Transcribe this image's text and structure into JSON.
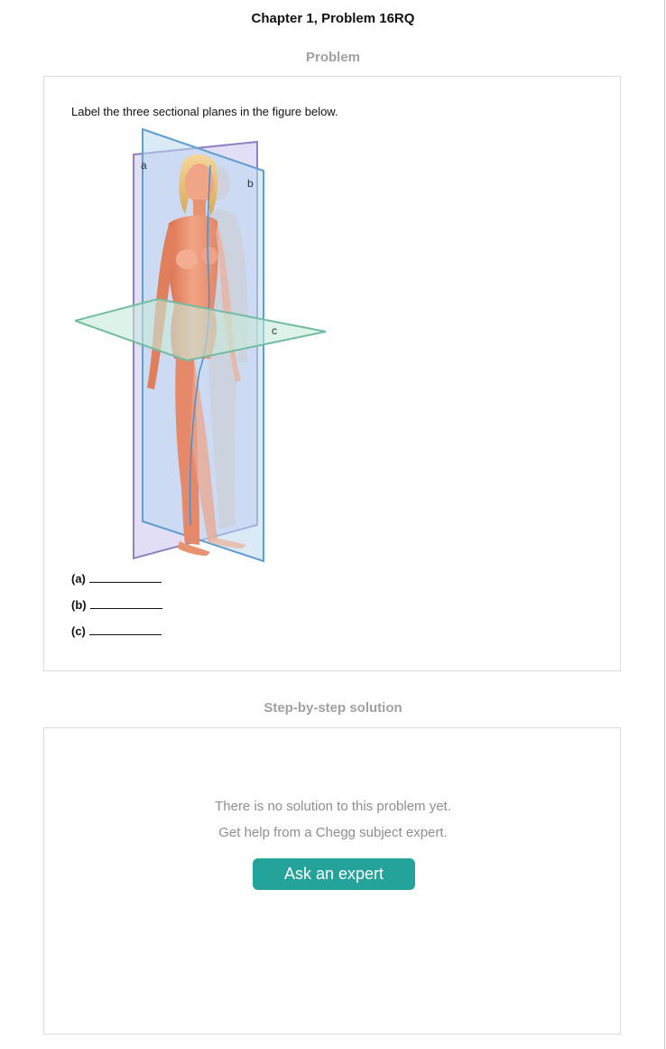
{
  "header": {
    "title": "Chapter 1, Problem 16RQ"
  },
  "problem": {
    "heading": "Problem",
    "question": "Label the three sectional planes in the figure below.",
    "figure": {
      "label_a": "a",
      "label_b": "b",
      "label_c": "c",
      "colors": {
        "plane_a": "#9b8fc4",
        "plane_b": "#6fa8d6",
        "plane_c": "#7cc2a6",
        "skin": "#e9906b"
      }
    },
    "answers": [
      {
        "label": "(a)"
      },
      {
        "label": "(b)"
      },
      {
        "label": "(c)"
      }
    ]
  },
  "solution": {
    "heading": "Step-by-step solution",
    "message_line1": "There is no solution to this problem yet.",
    "message_line2": "Get help from a Chegg subject expert.",
    "button_label": "Ask an expert",
    "button_color": "#24a39a"
  }
}
